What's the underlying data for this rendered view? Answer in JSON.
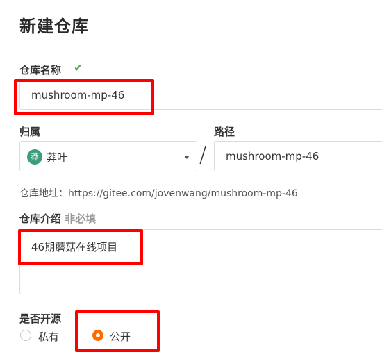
{
  "page": {
    "title": "新建仓库"
  },
  "repo_name": {
    "label": "仓库名称",
    "status_icon": "check-icon",
    "value": "mushroom-mp-46"
  },
  "owner": {
    "label": "归属",
    "avatar_text": "莽",
    "value": "莽叶",
    "dropdown_icon": "caret-down-icon"
  },
  "separator": "/",
  "path": {
    "label": "路径",
    "value": "mushroom-mp-46"
  },
  "repo_address": {
    "label": "仓库地址：",
    "url": "https://gitee.com/jovenwang/mushroom-mp-46"
  },
  "description": {
    "label": "仓库介绍",
    "optional_tag": "非必填",
    "value": "46期蘑菇在线项目"
  },
  "visibility": {
    "label": "是否开源",
    "options": [
      {
        "label": "私有",
        "selected": false
      },
      {
        "label": "公开",
        "selected": true
      }
    ]
  },
  "colors": {
    "accent": "#ff6a00",
    "check": "#4caf50",
    "highlight": "#ff0000",
    "avatar": "#3b9e7b"
  }
}
